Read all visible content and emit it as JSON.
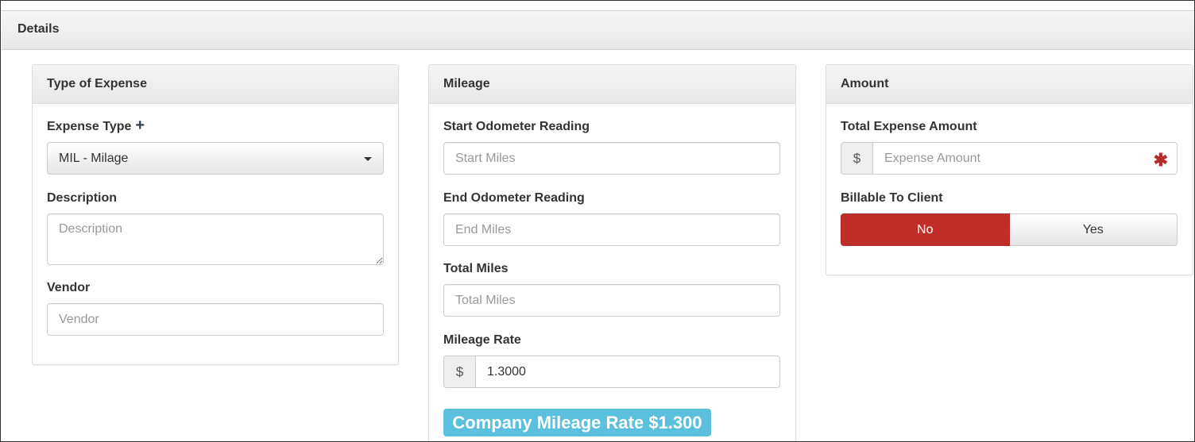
{
  "details": {
    "title": "Details"
  },
  "type_panel": {
    "title": "Type of Expense",
    "expense_type_label": "Expense Type",
    "expense_type_value": "MIL - Milage",
    "description_label": "Description",
    "description_placeholder": "Description",
    "vendor_label": "Vendor",
    "vendor_placeholder": "Vendor"
  },
  "mileage_panel": {
    "title": "Mileage",
    "start_label": "Start Odometer Reading",
    "start_placeholder": "Start Miles",
    "end_label": "End Odometer Reading",
    "end_placeholder": "End Miles",
    "total_label": "Total Miles",
    "total_placeholder": "Total Miles",
    "rate_label": "Mileage Rate",
    "rate_currency": "$",
    "rate_value": "1.3000",
    "company_rate_badge": "Company Mileage Rate $1.300"
  },
  "amount_panel": {
    "title": "Amount",
    "total_label": "Total Expense Amount",
    "currency": "$",
    "amount_placeholder": "Expense Amount",
    "required_marker": "✱",
    "billable_label": "Billable To Client",
    "billable_no": "No",
    "billable_yes": "Yes",
    "billable_selected": "No"
  },
  "colors": {
    "danger": "#c12e2a",
    "info": "#5bc0de",
    "required": "#b52b27"
  },
  "icons": {
    "add": "plus-icon",
    "dropdown": "caret-down-icon",
    "required": "asterisk-icon"
  }
}
